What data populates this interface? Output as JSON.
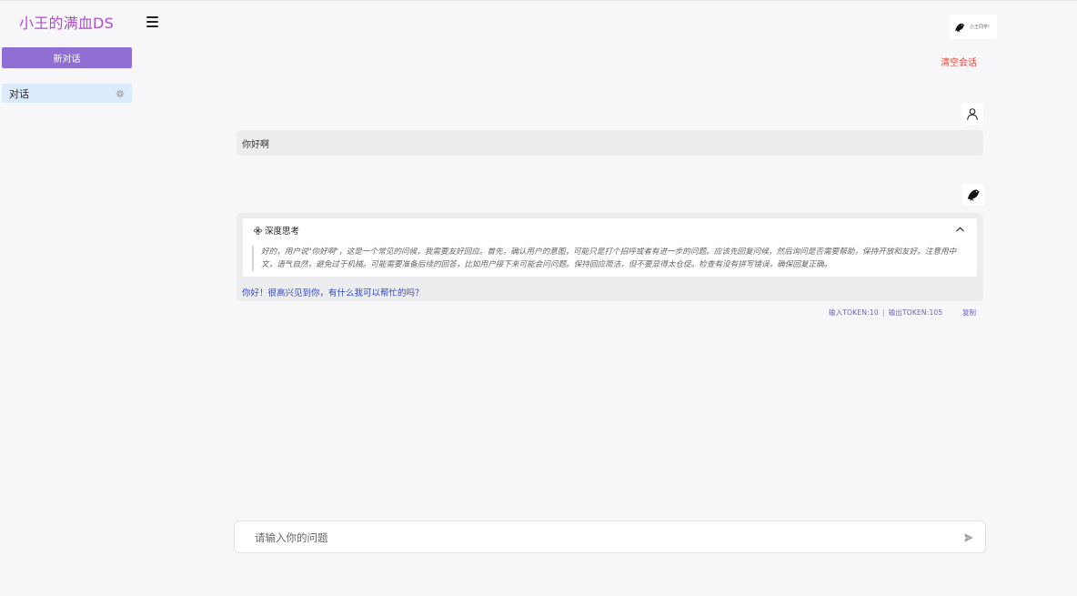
{
  "sidebar": {
    "brand": "小王的满血DS",
    "new_chat_label": "新对话",
    "conversations": [
      {
        "label": "对话"
      }
    ]
  },
  "header": {
    "avatar_text": "小王同学!",
    "clear_label": "清空会话"
  },
  "chat": {
    "messages": [
      {
        "role": "user",
        "text": "你好啊"
      },
      {
        "role": "assistant",
        "think_title": "深度思考",
        "think_text": "好的，用户说\"你好啊\"，这是一个常见的问候，我需要友好回应。首先，确认用户的意图，可能只是打个招呼或者有进一步的问题。应该先回复问候，然后询问是否需要帮助，保持开放和友好。注意用中文，语气自然，避免过于机械。可能需要准备后续的回答，比如用户接下来可能会问问题。保持回应简洁，但不要显得太仓促。检查有没有拼写错误，确保回复正确。",
        "answer": "你好！很高兴见到你，有什么我可以帮忙的吗？",
        "input_tokens": "输入TOKEN:10",
        "output_tokens": "输出TOKEN:105",
        "copy_label": "复制"
      }
    ]
  },
  "composer": {
    "placeholder": "请输入你的问题"
  },
  "icons": {
    "menu": "menu-icon",
    "gear": "gear-icon",
    "user": "user-icon",
    "bot": "bird-avatar-icon",
    "chevron": "chevron-up-icon",
    "send": "send-icon",
    "flower": "flower-icon"
  },
  "colors": {
    "brand": "#b04ccf",
    "primary_button": "#8f6fd4",
    "conversation_active": "#dcebfc",
    "clear": "#e24a3b",
    "answer": "#3448c7",
    "token": "#6a63b8"
  }
}
